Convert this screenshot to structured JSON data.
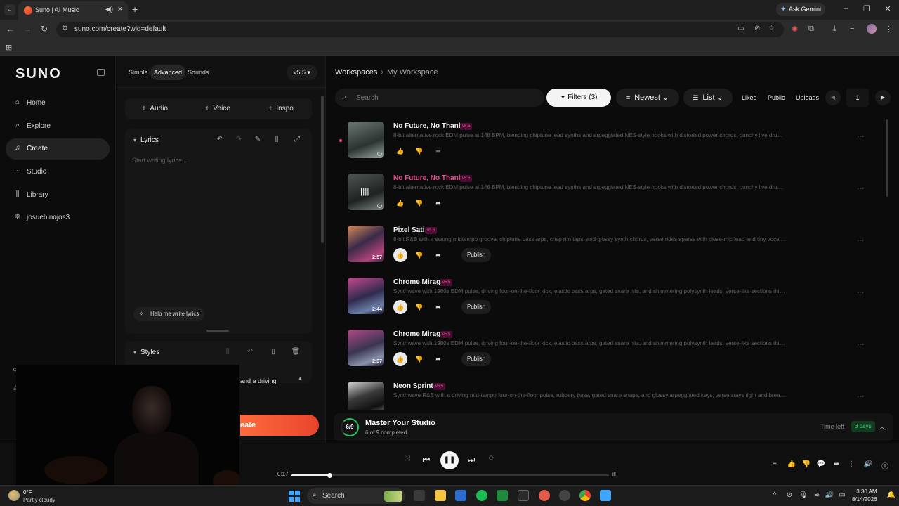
{
  "browser": {
    "tab_title": "Suno | AI Music",
    "ask_gemini": "Ask Gemini",
    "url": "suno.com/create?wid=default"
  },
  "sidebar": {
    "logo": "SUNO",
    "items": [
      {
        "label": "Home",
        "icon": "home-icon"
      },
      {
        "label": "Explore",
        "icon": "search-icon"
      },
      {
        "label": "Create",
        "icon": "music-note-icon"
      },
      {
        "label": "Studio",
        "icon": "studio-icon"
      },
      {
        "label": "Library",
        "icon": "library-icon"
      },
      {
        "label": "josuehinojos3",
        "icon": "user-icon"
      }
    ]
  },
  "create": {
    "modes": [
      "Simple",
      "Advanced",
      "Sounds"
    ],
    "active_mode": "Advanced",
    "version": "v5.5",
    "buttons": [
      "Audio",
      "Voice",
      "Inspo"
    ],
    "lyrics_title": "Lyrics",
    "lyrics_placeholder": "Start writing lyrics...",
    "help_button": "Help me write lyrics",
    "styles_title": "Styles",
    "styles_partial": "and a driving",
    "create_button": "eate"
  },
  "main": {
    "breadcrumb": {
      "root": "Workspaces",
      "current": "My Workspace"
    },
    "search_placeholder": "Search",
    "filters": "Filters (3)",
    "sort": "Newest",
    "view": "List",
    "toggles": [
      "Liked",
      "Public",
      "Uploads"
    ],
    "page": "1",
    "songs": [
      {
        "title": "No Future, No Thanks",
        "version": "v5.5",
        "desc": "8-bit alternative rock EDM pulse at 148 BPM, blending chiptune lead synths and arpeggiated NES-style hooks with distorted power chords, punchy live drums, and si...",
        "duration": "",
        "publish": "",
        "highlight": false
      },
      {
        "title": "No Future, No Thanks",
        "version": "v5.5",
        "desc": "8-bit alternative rock EDM pulse at 148 BPM, blending chiptune lead synths and arpeggiated NES-style hooks with distorted power chords, punchy live drums, and si...",
        "duration": "",
        "publish": "",
        "highlight": true
      },
      {
        "title": "Pixel Satin",
        "version": "v5.5",
        "desc": "8-bit R&B with a swung midtempo groove, chiptune bass arps, crisp rim taps, and glossy synth chords, verse rides sparse with close-mic lead and tiny vocal glitches, ...",
        "duration": "2:57",
        "publish": "Publish",
        "highlight": false
      },
      {
        "title": "Chrome Mirage",
        "version": "v5.5",
        "desc": "Synthwave with 1980s EDM pulse, driving four-on-the-floor kick, elastic bass arps, gated snare hits, and shimmering polysynth leads, verse-like sections thin to drum ...",
        "duration": "2:44",
        "publish": "Publish",
        "highlight": false
      },
      {
        "title": "Chrome Mirage",
        "version": "v5.5",
        "desc": "Synthwave with 1980s EDM pulse, driving four-on-the-floor kick, elastic bass arps, gated snare hits, and shimmering polysynth leads, verse-like sections thin to drum ...",
        "duration": "2:37",
        "publish": "Publish",
        "highlight": false
      },
      {
        "title": "Neon Sprint",
        "version": "v5.5",
        "desc": "Synthwave R&B with a driving mid-tempo four-on-the-floor pulse, rubbery bass, gated snare snaps, and glossy arpeggiated keys, verse stays tight and breathy over s...",
        "duration": "",
        "publish": "",
        "highlight": false
      }
    ],
    "studio": {
      "progress": "6/9",
      "title": "Master Your Studio",
      "sub": "6 of 9 completed",
      "time_left_label": "Time left",
      "days": "3 days"
    }
  },
  "player": {
    "current_time": "0:17",
    "progress_fraction": 0.12
  },
  "taskbar": {
    "weather_temp": "0°F",
    "weather": "Partly cloudy",
    "search": "Search",
    "time": "3:30 AM",
    "date": "8/14/2026"
  }
}
